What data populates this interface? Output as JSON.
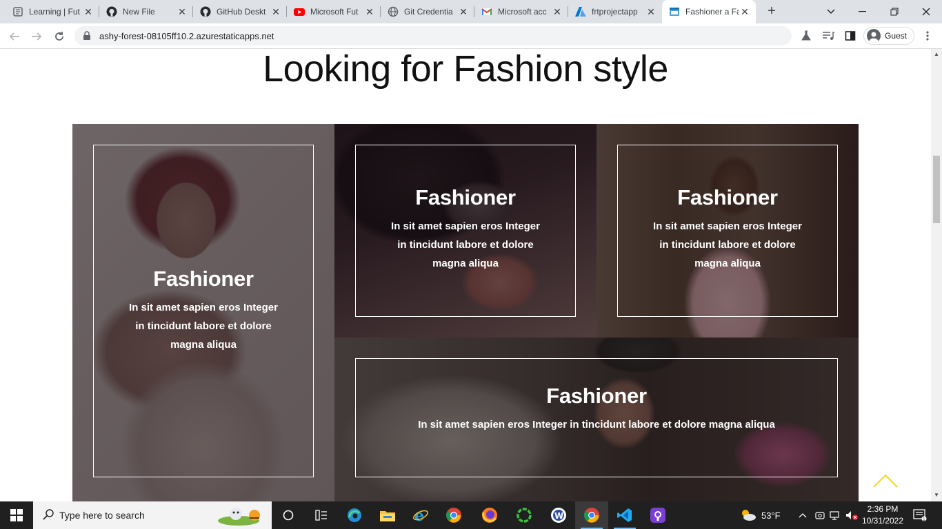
{
  "browser": {
    "tabs": [
      {
        "title": "Learning | Fut",
        "icon": "learning-icon"
      },
      {
        "title": "New File",
        "icon": "github-icon"
      },
      {
        "title": "GitHub Deskt",
        "icon": "github-icon"
      },
      {
        "title": "Microsoft Fut",
        "icon": "youtube-icon"
      },
      {
        "title": "Git Credentia",
        "icon": "globe-icon"
      },
      {
        "title": "Microsoft acc",
        "icon": "gmail-icon"
      },
      {
        "title": "frtprojectapp",
        "icon": "azure-icon"
      },
      {
        "title": "Fashioner a Fa",
        "icon": "site-icon",
        "active": true
      }
    ],
    "new_tab": "+",
    "url": "ashy-forest-08105ff10.2.azurestaticapps.net",
    "profile": "Guest"
  },
  "page": {
    "heading": "Looking for Fashion style",
    "cards": [
      {
        "title": "Fashioner",
        "text_lines": [
          "In sit amet sapien eros Integer",
          "in tincidunt labore et dolore",
          "magna aliqua"
        ]
      },
      {
        "title": "Fashioner",
        "text_lines": [
          "In sit amet sapien eros Integer",
          "in tincidunt labore et dolore",
          "magna aliqua"
        ]
      },
      {
        "title": "Fashioner",
        "text_lines": [
          "In sit amet sapien eros Integer",
          "in tincidunt labore et dolore",
          "magna aliqua"
        ]
      },
      {
        "title": "Fashioner",
        "text_lines": [
          "In sit amet sapien eros Integer in tincidunt labore et dolore magna aliqua"
        ]
      }
    ],
    "accent_color": "#f2d51f"
  },
  "taskbar": {
    "search_placeholder": "Type here to search",
    "weather": "53°F",
    "time": "2:36 PM",
    "date": "10/31/2022"
  }
}
